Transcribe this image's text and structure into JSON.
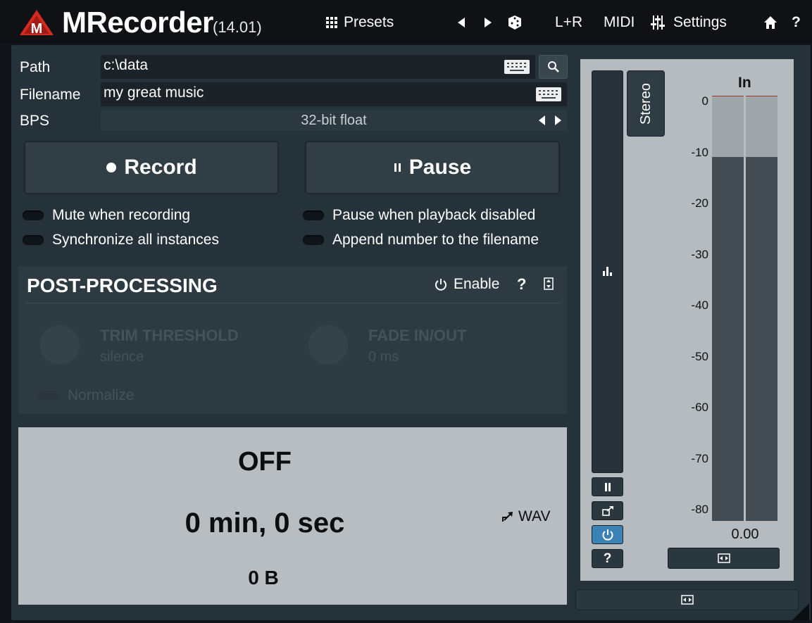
{
  "header": {
    "app_name": "MRecorder",
    "version": "(14.01)",
    "presets_label": "Presets",
    "channel_label": "L+R",
    "midi_label": "MIDI",
    "settings_label": "Settings",
    "help_label": "?"
  },
  "file": {
    "path_label": "Path",
    "path_value": "c:\\data",
    "filename_label": "Filename",
    "filename_value": "my great music",
    "bps_label": "BPS",
    "bps_value": "32-bit float"
  },
  "transport": {
    "record_label": "Record",
    "pause_label": "Pause"
  },
  "options": {
    "mute_when_recording": "Mute when recording",
    "synchronize_all": "Synchronize all instances",
    "pause_when_playback_disabled": "Pause when playback disabled",
    "append_number": "Append number to the filename"
  },
  "post_processing": {
    "title": "POST-PROCESSING",
    "enable_label": "Enable",
    "help_label": "?",
    "trim_label": "TRIM THRESHOLD",
    "trim_value": "silence",
    "fade_label": "FADE IN/OUT",
    "fade_value": "0 ms",
    "normalize_label": "Normalize"
  },
  "status": {
    "state": "OFF",
    "duration": "0 min, 0 sec",
    "size": "0 B",
    "format": "WAV"
  },
  "meter": {
    "stereo_label": "Stereo",
    "in_label": "In",
    "scale": [
      "0",
      "-10",
      "-20",
      "-30",
      "-40",
      "-50",
      "-60",
      "-70",
      "-80"
    ],
    "scale_db": [
      0,
      -10,
      -20,
      -30,
      -40,
      -50,
      -60,
      -70,
      -80
    ],
    "value": "0.00",
    "help_label": "?",
    "colors": {
      "peak": "#9a3a2a",
      "active": "#3d82b4"
    }
  }
}
